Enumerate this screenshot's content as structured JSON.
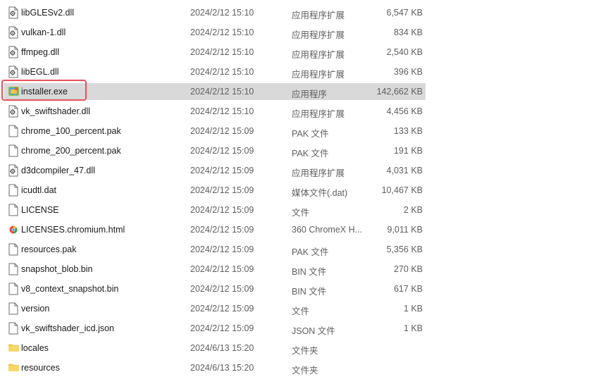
{
  "files": [
    {
      "name": "libGLESv2.dll",
      "date": "2024/2/12 15:10",
      "type": "应用程序扩展",
      "size": "6,547 KB",
      "icon": "dll-file-icon"
    },
    {
      "name": "vulkan-1.dll",
      "date": "2024/2/12 15:10",
      "type": "应用程序扩展",
      "size": "834 KB",
      "icon": "dll-file-icon"
    },
    {
      "name": "ffmpeg.dll",
      "date": "2024/2/12 15:10",
      "type": "应用程序扩展",
      "size": "2,540 KB",
      "icon": "dll-file-icon"
    },
    {
      "name": "libEGL.dll",
      "date": "2024/2/12 15:10",
      "type": "应用程序扩展",
      "size": "396 KB",
      "icon": "dll-file-icon"
    },
    {
      "name": "installer.exe",
      "date": "2024/2/12 15:10",
      "type": "应用程序",
      "size": "142,662 KB",
      "icon": "installer-exe-icon",
      "selected": true
    },
    {
      "name": "vk_swiftshader.dll",
      "date": "2024/2/12 15:10",
      "type": "应用程序扩展",
      "size": "4,456 KB",
      "icon": "dll-file-icon"
    },
    {
      "name": "chrome_100_percent.pak",
      "date": "2024/2/12 15:09",
      "type": "PAK 文件",
      "size": "133 KB",
      "icon": "blank-file-icon"
    },
    {
      "name": "chrome_200_percent.pak",
      "date": "2024/2/12 15:09",
      "type": "PAK 文件",
      "size": "191 KB",
      "icon": "blank-file-icon"
    },
    {
      "name": "d3dcompiler_47.dll",
      "date": "2024/2/12 15:09",
      "type": "应用程序扩展",
      "size": "4,031 KB",
      "icon": "dll-file-icon"
    },
    {
      "name": "icudtl.dat",
      "date": "2024/2/12 15:09",
      "type": "媒体文件(.dat)",
      "size": "10,467 KB",
      "icon": "blank-file-icon"
    },
    {
      "name": "LICENSE",
      "date": "2024/2/12 15:09",
      "type": "文件",
      "size": "2 KB",
      "icon": "blank-file-icon"
    },
    {
      "name": "LICENSES.chromium.html",
      "date": "2024/2/12 15:09",
      "type": "360 ChromeX H...",
      "size": "9,011 KB",
      "icon": "html-file-icon"
    },
    {
      "name": "resources.pak",
      "date": "2024/2/12 15:09",
      "type": "PAK 文件",
      "size": "5,356 KB",
      "icon": "blank-file-icon"
    },
    {
      "name": "snapshot_blob.bin",
      "date": "2024/2/12 15:09",
      "type": "BIN 文件",
      "size": "270 KB",
      "icon": "blank-file-icon"
    },
    {
      "name": "v8_context_snapshot.bin",
      "date": "2024/2/12 15:09",
      "type": "BIN 文件",
      "size": "617 KB",
      "icon": "blank-file-icon"
    },
    {
      "name": "version",
      "date": "2024/2/12 15:09",
      "type": "文件",
      "size": "1 KB",
      "icon": "blank-file-icon"
    },
    {
      "name": "vk_swiftshader_icd.json",
      "date": "2024/2/12 15:09",
      "type": "JSON 文件",
      "size": "1 KB",
      "icon": "blank-file-icon"
    },
    {
      "name": "locales",
      "date": "2024/6/13 15:20",
      "type": "文件夹",
      "size": "",
      "icon": "folder-icon"
    },
    {
      "name": "resources",
      "date": "2024/6/13 15:20",
      "type": "文件夹",
      "size": "",
      "icon": "folder-icon"
    }
  ],
  "colors": {
    "selected_row": "#d9d9d9",
    "highlight_border": "#e8505b",
    "folder": "#f3c649",
    "secondary_text": "#5f5f5f"
  }
}
